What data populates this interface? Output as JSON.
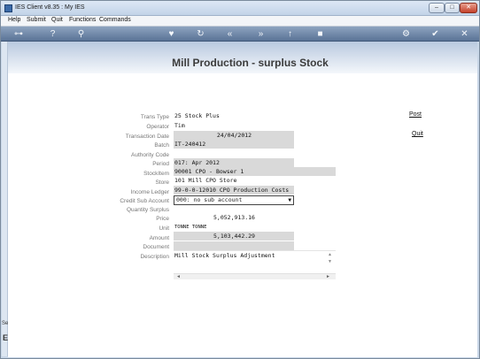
{
  "window": {
    "title": "IES Client v8.35 : My IES"
  },
  "menu": {
    "items": [
      "Help",
      "Submit",
      "Quit",
      "Functions",
      "Commands"
    ]
  },
  "toolbar": {
    "icons": [
      "key-icon",
      "help-icon",
      "search-icon",
      "heart-icon",
      "refresh-icon",
      "rewind-icon",
      "fast-forward-icon",
      "upload-icon",
      "stop-icon",
      "settings-icon",
      "check-icon",
      "close-icon"
    ]
  },
  "sidebar": {
    "text": "Se",
    "mark": "E"
  },
  "page": {
    "title": "Mill Production - surplus Stock"
  },
  "actions": {
    "post": "Post",
    "quit": "Quit"
  },
  "form": {
    "fields": [
      {
        "label": "Trans Type",
        "value": "25 Stock Plus"
      },
      {
        "label": "Operator",
        "value": "Tim"
      },
      {
        "label": "Transaction Date",
        "value": "24/04/2012"
      },
      {
        "label": "Batch",
        "value": "IT-240412"
      },
      {
        "label": "Authority Code",
        "value": ""
      },
      {
        "label": "Period",
        "value": "017: Apr 2012"
      },
      {
        "label": "StockItem",
        "value": "90001 CPO - Bowser 1"
      },
      {
        "label": "Store",
        "value": "101 Mill CPO Store"
      },
      {
        "label": "Income Ledger",
        "value": "99-0-0-12010 CPO Production Costs"
      },
      {
        "label": "Credit Sub Account",
        "value": "000: no sub account"
      },
      {
        "label": "Quantity Surplus",
        "value": ""
      },
      {
        "label": "Price",
        "value": "5,052,913.16"
      },
      {
        "label": "Unit",
        "value": "TONNE TONNE"
      },
      {
        "label": "Amount",
        "value": "5,103,442.29"
      },
      {
        "label": "Document",
        "value": ""
      },
      {
        "label": "Description",
        "value": "Mill Stock Surplus Adjustment"
      }
    ]
  }
}
